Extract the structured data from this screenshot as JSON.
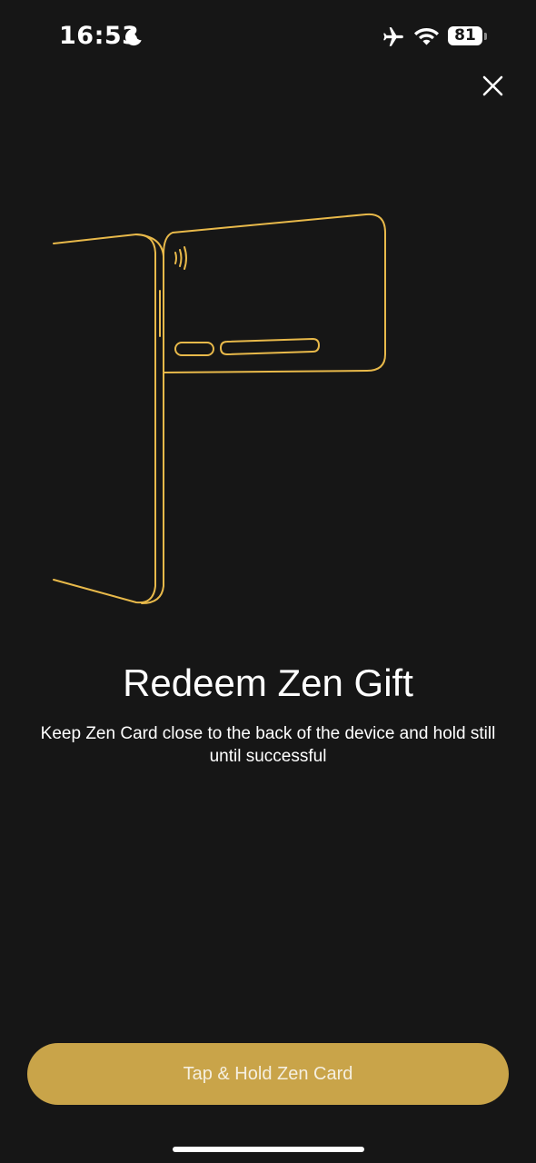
{
  "status_bar": {
    "time": "16:53",
    "battery_level": "81",
    "icons": [
      "moon-icon",
      "airplane-icon",
      "wifi-icon",
      "battery-icon"
    ]
  },
  "header": {
    "close_icon": "close-icon"
  },
  "illustration": {
    "name": "phone-and-card-illustration",
    "stroke_color": "#e8b94a"
  },
  "content": {
    "title": "Redeem Zen Gift",
    "subtitle": "Keep Zen Card close to the back of the device and hold still until successful"
  },
  "actions": {
    "primary_label": "Tap & Hold Zen Card"
  },
  "colors": {
    "background": "#161616",
    "accent": "#c9a449",
    "button_text": "#f5efe0",
    "text": "#ffffff"
  }
}
